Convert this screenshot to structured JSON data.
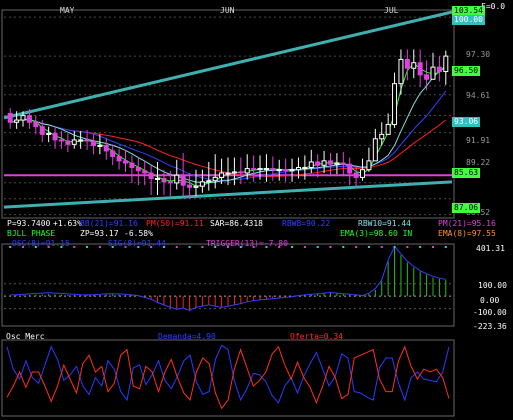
{
  "chart_data": [
    {
      "type": "candlestick",
      "title": "",
      "months": [
        "MAY",
        "JUN",
        "JUL"
      ],
      "corner_label": "F=0.0",
      "y_ticks": [
        "103.54",
        "100.00",
        "97.30",
        "96.50",
        "94.61",
        "93.06",
        "91.91",
        "89.22",
        "88.52",
        "87.06",
        "85.63"
      ],
      "y_range": [
        85.5,
        104.0
      ],
      "grid": true,
      "candles": {
        "open": [
          94.8,
          94.0,
          94.2,
          94.6,
          94.0,
          93.6,
          92.9,
          93.0,
          92.4,
          92.3,
          92.0,
          92.4,
          92.4,
          92.3,
          91.9,
          91.9,
          91.4,
          90.9,
          90.5,
          90.3,
          89.9,
          89.6,
          89.4,
          88.9,
          88.9,
          88.6,
          88.5,
          89.2,
          88.3,
          88.1,
          88.2,
          88.6,
          88.7,
          89.0,
          89.4,
          89.4,
          89.5,
          89.4,
          89.8,
          89.7,
          89.8,
          89.8,
          89.7,
          89.7,
          89.6,
          89.7,
          89.9,
          89.9,
          90.4,
          90.1,
          90.5,
          90.2,
          90.3,
          90.2,
          89.4,
          89.0,
          89.7,
          90.5,
          92.5,
          92.9,
          93.8,
          97.5,
          99.7,
          98.9,
          99.4,
          98.3,
          97.9,
          99.0,
          98.6
        ],
        "close": [
          94.0,
          94.2,
          94.6,
          94.0,
          93.6,
          92.9,
          93.0,
          92.4,
          92.3,
          92.0,
          92.4,
          92.4,
          92.3,
          91.9,
          91.9,
          91.4,
          90.9,
          90.5,
          90.3,
          89.9,
          89.6,
          89.4,
          88.9,
          88.9,
          88.6,
          88.5,
          89.2,
          88.3,
          88.1,
          88.2,
          88.6,
          88.7,
          89.0,
          89.4,
          89.4,
          89.5,
          89.4,
          89.8,
          89.7,
          89.8,
          89.8,
          89.7,
          89.7,
          89.6,
          89.7,
          89.9,
          89.9,
          90.4,
          90.1,
          90.5,
          90.2,
          90.3,
          90.2,
          89.4,
          89.0,
          89.7,
          90.5,
          92.5,
          92.9,
          93.8,
          97.5,
          99.7,
          98.9,
          99.4,
          98.3,
          97.9,
          99.0,
          98.6,
          100.0
        ],
        "high": [
          95.3,
          95.0,
          95.0,
          95.2,
          94.6,
          94.2,
          93.6,
          93.6,
          93.2,
          93.0,
          93.2,
          93.2,
          93.3,
          92.9,
          92.9,
          92.6,
          92.0,
          91.6,
          91.5,
          91.0,
          90.8,
          90.5,
          90.2,
          90.4,
          89.7,
          89.6,
          90.6,
          91.2,
          89.4,
          89.7,
          89.7,
          90.4,
          91.1,
          90.7,
          90.8,
          90.8,
          90.8,
          91.1,
          91.0,
          91.0,
          91.1,
          90.9,
          90.6,
          90.7,
          90.7,
          90.8,
          91.0,
          91.5,
          91.1,
          91.4,
          91.2,
          91.2,
          91.3,
          90.8,
          90.1,
          90.7,
          91.7,
          93.4,
          94.0,
          94.8,
          98.5,
          100.6,
          100.6,
          100.6,
          100.6,
          99.6,
          100.3,
          100.0,
          100.5
        ],
        "low": [
          93.4,
          93.4,
          93.6,
          93.4,
          92.9,
          92.2,
          92.2,
          91.6,
          91.6,
          91.3,
          91.6,
          91.6,
          91.5,
          91.1,
          91.1,
          90.6,
          90.1,
          89.7,
          89.5,
          88.5,
          88.3,
          88.3,
          87.4,
          87.4,
          87.4,
          87.3,
          87.9,
          87.3,
          87.1,
          87.3,
          87.6,
          87.8,
          88.0,
          88.4,
          88.3,
          88.3,
          88.4,
          88.8,
          88.6,
          88.8,
          88.6,
          88.7,
          88.7,
          88.6,
          88.6,
          88.9,
          88.8,
          89.4,
          89.0,
          89.4,
          89.1,
          89.3,
          89.1,
          88.3,
          88.0,
          88.7,
          89.5,
          91.5,
          91.9,
          92.9,
          93.5,
          96.5,
          97.8,
          98.0,
          97.2,
          96.9,
          97.9,
          97.7,
          97.4
        ]
      },
      "labels": {
        "price": "P=93.7400",
        "price_change": "+1.63%",
        "bb": "BB(21)=91.16",
        "pm": "PM(50)=91.11",
        "sar": "SAR=86.4318",
        "rbw8": "RBW8=90.22",
        "rbw10": "RBW10=91.44",
        "pm_right": "PM(21)=95.16",
        "bjll": "BJLL PHASE",
        "zp": "ZP=93.17",
        "zp_change": "-6.58%",
        "ema3": "EMA(3)=98.60 IN",
        "ema": "EMA(8)=97.55",
        "sub1": "OSC(8)=91.15",
        "sub2": "SIG(8)=91.44",
        "sub3": "TRIGGER(13)=-7.80"
      }
    },
    {
      "type": "bar",
      "title": "",
      "y_ticks": [
        "401.31",
        "100.00",
        "0.00",
        "-100.00",
        "-223.36"
      ],
      "y_range": [
        -240,
        420
      ],
      "bars": [
        3,
        5,
        8,
        10,
        12,
        14,
        16,
        14,
        12,
        10,
        9,
        8,
        6,
        8,
        10,
        12,
        14,
        12,
        9,
        6,
        2,
        -15,
        -30,
        -55,
        -75,
        -95,
        -110,
        -100,
        -120,
        -90,
        -80,
        -70,
        -85,
        -95,
        -80,
        -75,
        -60,
        -45,
        -35,
        -30,
        -25,
        -20,
        -15,
        -10,
        -5,
        5,
        10,
        15,
        20,
        25,
        30,
        25,
        20,
        15,
        10,
        5,
        20,
        50,
        120,
        280,
        401,
        330,
        270,
        230,
        200,
        175,
        150,
        140,
        130
      ],
      "line": [
        10,
        12,
        15,
        18,
        22,
        25,
        28,
        25,
        22,
        18,
        15,
        12,
        10,
        12,
        15,
        18,
        20,
        18,
        15,
        10,
        5,
        -10,
        -25,
        -50,
        -70,
        -90,
        -105,
        -95,
        -115,
        -90,
        -80,
        -70,
        -80,
        -90,
        -80,
        -70,
        -60,
        -45,
        -35,
        -30,
        -25,
        -20,
        -15,
        -10,
        -5,
        5,
        10,
        15,
        20,
        25,
        30,
        25,
        20,
        15,
        10,
        5,
        25,
        60,
        130,
        290,
        401,
        340,
        280,
        240,
        205,
        180,
        160,
        145,
        135
      ]
    },
    {
      "type": "line",
      "title": "Osc Merc",
      "legend": [
        "Demanda=4.90",
        "Oferta=0.34"
      ],
      "series": [
        {
          "name": "Demanda",
          "color": "#2a3bff",
          "values": [
            4.8,
            3.2,
            2.5,
            3.8,
            2.6,
            2.2,
            3.5,
            4.8,
            3.9,
            2.4,
            2.8,
            3.4,
            2.0,
            1.4,
            2.6,
            2.0,
            3.8,
            3.2,
            1.6,
            1.0,
            3.3,
            3.5,
            2.1,
            2.8,
            3.8,
            2.4,
            1.8,
            2.7,
            3.8,
            4.2,
            2.3,
            1.4,
            1.6,
            3.9,
            4.9,
            4.6,
            2.4,
            1.0,
            1.8,
            2.9,
            2.8,
            2.3,
            1.3,
            0.8,
            2.0,
            2.6,
            1.5,
            2.7,
            3.6,
            4.4,
            3.2,
            2.0,
            2.7,
            4.3,
            4.0,
            1.6,
            1.5,
            1.2,
            1.0,
            3.3,
            4.0,
            4.0,
            2.2,
            1.0,
            2.6,
            3.0,
            2.5,
            2.4,
            2.3,
            3.0,
            4.8
          ]
        },
        {
          "name": "Oferta",
          "color": "#ff3018",
          "values": [
            1.2,
            2.0,
            3.0,
            1.9,
            3.0,
            3.0,
            2.0,
            0.9,
            2.0,
            3.5,
            2.5,
            1.5,
            3.6,
            4.2,
            3.0,
            3.4,
            1.6,
            2.2,
            4.2,
            4.6,
            2.0,
            1.8,
            3.4,
            3.0,
            1.6,
            3.0,
            3.9,
            2.6,
            1.5,
            1.0,
            3.0,
            4.0,
            3.6,
            1.5,
            0.4,
            1.0,
            3.2,
            4.6,
            3.3,
            2.0,
            2.4,
            3.0,
            4.3,
            4.8,
            3.5,
            2.5,
            3.7,
            2.6,
            1.9,
            0.8,
            2.0,
            3.4,
            2.6,
            1.1,
            1.4,
            4.0,
            4.2,
            4.4,
            4.6,
            2.5,
            1.6,
            1.6,
            3.8,
            4.8,
            3.4,
            2.5,
            3.2,
            3.0,
            3.2,
            2.6,
            1.1
          ]
        }
      ],
      "y_range": [
        0,
        5
      ]
    }
  ],
  "colors": {
    "up": "#ffffff",
    "down": "#e040e0",
    "channel": "#3fb0b0",
    "grid": "#4a4a4a",
    "pm": "#ff2020",
    "sar": "#ffffff",
    "rbw8": "#3040ff",
    "rbw10": "#80e0e0",
    "ema3": "#20ff20",
    "zp": "#ffffff"
  }
}
